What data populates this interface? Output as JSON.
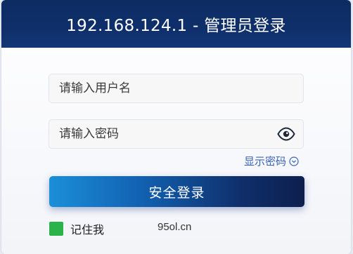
{
  "header": {
    "title": "192.168.124.1 - 管理员登录"
  },
  "form": {
    "username_placeholder": "请输入用户名",
    "username_value": "",
    "password_placeholder": "请输入密码",
    "password_value": "",
    "show_password_label": "显示密码",
    "submit_label": "安全登录",
    "remember_label": "记住我",
    "remember_checked": true
  },
  "watermark": "95ol.cn",
  "icons": {
    "password_toggle": "eye-icon",
    "show_password_indicator": "chevron-down-circle-icon"
  },
  "colors": {
    "header_bg": "#0f2f6b",
    "button_start": "#1b8fd8",
    "button_end": "#0d1f4e",
    "link": "#3a63b8",
    "checkbox": "#2bb24a"
  }
}
